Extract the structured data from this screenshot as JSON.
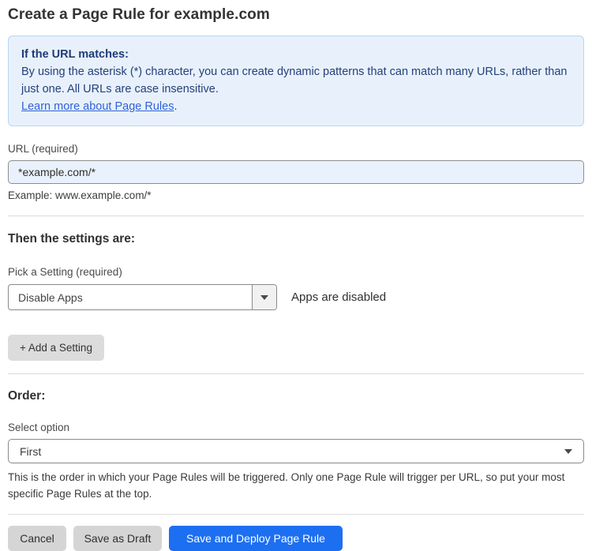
{
  "page": {
    "title": "Create a Page Rule for example.com"
  },
  "info_box": {
    "heading": "If the URL matches:",
    "body": "By using the asterisk (*) character, you can create dynamic patterns that can match many URLs, rather than just one. All URLs are case insensitive.",
    "link_label": "Learn more about Page Rules",
    "link_suffix": "."
  },
  "url_field": {
    "label": "URL (required)",
    "value": "*example.com/*",
    "example": "Example: www.example.com/*"
  },
  "settings_section": {
    "heading": "Then the settings are:",
    "picker_label": "Pick a Setting (required)",
    "picker_value": "Disable Apps",
    "status_text": "Apps are disabled",
    "add_setting_label": "+ Add a Setting"
  },
  "order_section": {
    "heading": "Order:",
    "select_label": "Select option",
    "select_value": "First",
    "help_text": "This is the order in which your Page Rules will be triggered. Only one Page Rule will trigger per URL, so put your most specific Page Rules at the top."
  },
  "footer": {
    "cancel_label": "Cancel",
    "save_draft_label": "Save as Draft",
    "save_deploy_label": "Save and Deploy Page Rule"
  },
  "colors": {
    "info_background": "#e8f1fb",
    "info_border": "#b9d6f2",
    "info_text": "#24407c",
    "link": "#2f62d8",
    "input_background": "#e9f1fc",
    "primary_button": "#1d6ff2",
    "secondary_button": "#d5d5d5"
  },
  "icons": {
    "dropdown_caret": "caret-down"
  }
}
